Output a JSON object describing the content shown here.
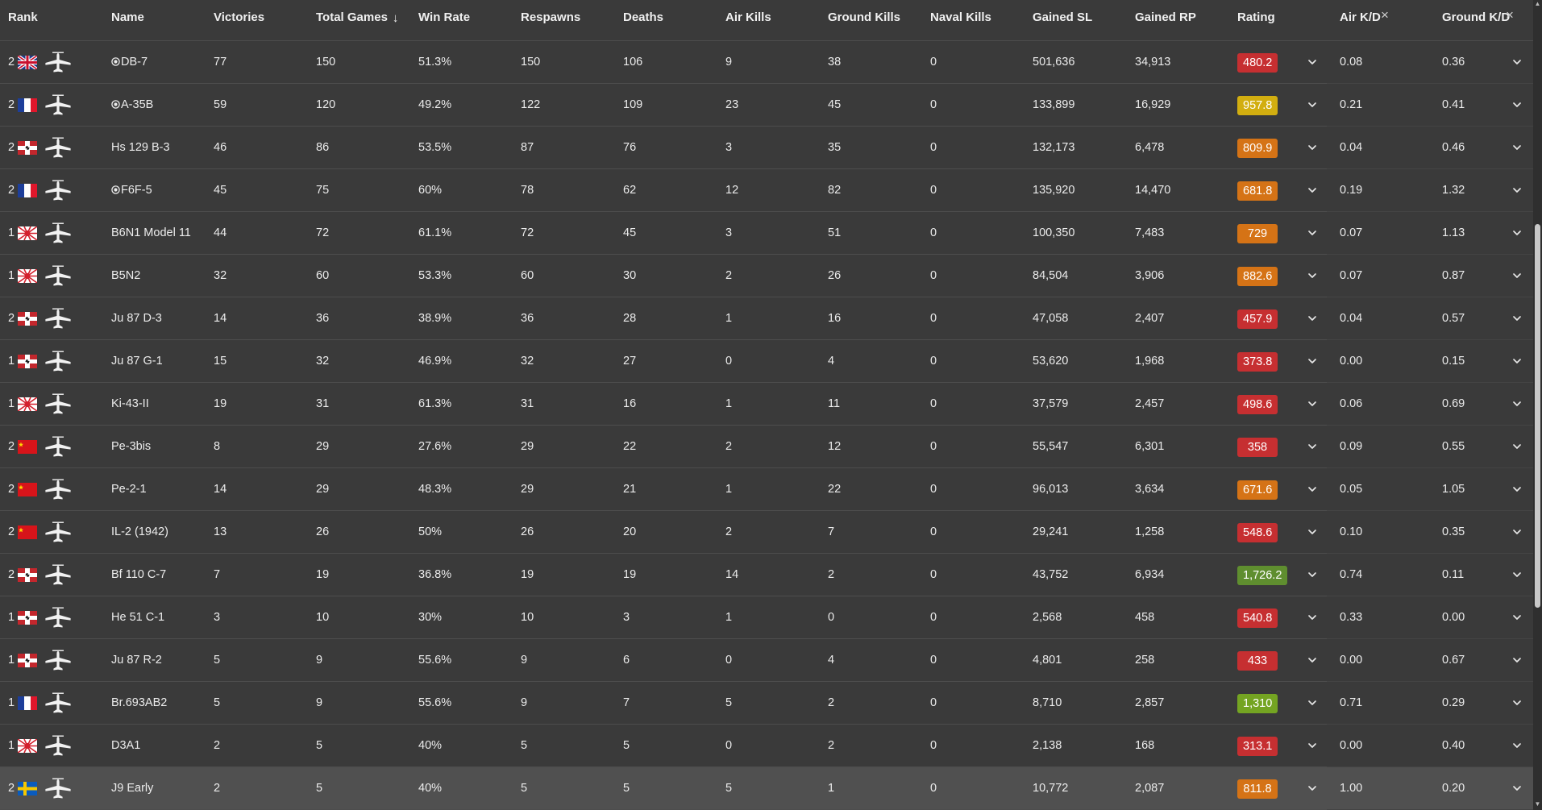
{
  "columns": {
    "rank": "Rank",
    "name": "Name",
    "victories": "Victories",
    "total_games": "Total Games",
    "win_rate": "Win Rate",
    "respawns": "Respawns",
    "deaths": "Deaths",
    "air_kills": "Air Kills",
    "ground_kills": "Ground Kills",
    "naval_kills": "Naval Kills",
    "gained_sl": "Gained SL",
    "gained_rp": "Gained RP",
    "rating": "Rating",
    "air_kd": "Air K/D",
    "ground_kd": "Ground K/D"
  },
  "icons": {
    "sort": "arrow-down-icon",
    "close": "close-icon",
    "expand": "chevron-down-icon",
    "vehicle": "plane-icon",
    "premium": "premium-target-icon"
  },
  "colors": {
    "rating_red": "#c62f31",
    "rating_orange": "#d57316",
    "rating_yellow": "#d2ae10",
    "rating_green": "#5f8e2f",
    "rating_lightgreen": "#74a422"
  },
  "rows": [
    {
      "rank": "2",
      "nation": "uk",
      "premium": true,
      "name": "DB-7",
      "victories": "77",
      "total": "150",
      "win_rate": "51.3%",
      "respawns": "150",
      "deaths": "106",
      "air_kills": "9",
      "ground_kills": "38",
      "naval_kills": "0",
      "sl": "501,636",
      "rp": "34,913",
      "rating": "480.2",
      "rating_color": "red",
      "air_kd": "0.08",
      "ground_kd": "0.36"
    },
    {
      "rank": "2",
      "nation": "france",
      "premium": true,
      "name": "A-35B",
      "victories": "59",
      "total": "120",
      "win_rate": "49.2%",
      "respawns": "122",
      "deaths": "109",
      "air_kills": "23",
      "ground_kills": "45",
      "naval_kills": "0",
      "sl": "133,899",
      "rp": "16,929",
      "rating": "957.8",
      "rating_color": "yellow",
      "air_kd": "0.21",
      "ground_kd": "0.41"
    },
    {
      "rank": "2",
      "nation": "germany",
      "premium": false,
      "name": "Hs 129 B-3",
      "victories": "46",
      "total": "86",
      "win_rate": "53.5%",
      "respawns": "87",
      "deaths": "76",
      "air_kills": "3",
      "ground_kills": "35",
      "naval_kills": "0",
      "sl": "132,173",
      "rp": "6,478",
      "rating": "809.9",
      "rating_color": "orange",
      "air_kd": "0.04",
      "ground_kd": "0.46"
    },
    {
      "rank": "2",
      "nation": "france",
      "premium": true,
      "name": "F6F-5",
      "victories": "45",
      "total": "75",
      "win_rate": "60%",
      "respawns": "78",
      "deaths": "62",
      "air_kills": "12",
      "ground_kills": "82",
      "naval_kills": "0",
      "sl": "135,920",
      "rp": "14,470",
      "rating": "681.8",
      "rating_color": "orange",
      "air_kd": "0.19",
      "ground_kd": "1.32"
    },
    {
      "rank": "1",
      "nation": "japan",
      "premium": false,
      "name": "B6N1 Model 11",
      "victories": "44",
      "total": "72",
      "win_rate": "61.1%",
      "respawns": "72",
      "deaths": "45",
      "air_kills": "3",
      "ground_kills": "51",
      "naval_kills": "0",
      "sl": "100,350",
      "rp": "7,483",
      "rating": "729",
      "rating_color": "orange",
      "air_kd": "0.07",
      "ground_kd": "1.13"
    },
    {
      "rank": "1",
      "nation": "japan",
      "premium": false,
      "name": "B5N2",
      "victories": "32",
      "total": "60",
      "win_rate": "53.3%",
      "respawns": "60",
      "deaths": "30",
      "air_kills": "2",
      "ground_kills": "26",
      "naval_kills": "0",
      "sl": "84,504",
      "rp": "3,906",
      "rating": "882.6",
      "rating_color": "orange",
      "air_kd": "0.07",
      "ground_kd": "0.87"
    },
    {
      "rank": "2",
      "nation": "germany",
      "premium": false,
      "name": "Ju 87 D-3",
      "victories": "14",
      "total": "36",
      "win_rate": "38.9%",
      "respawns": "36",
      "deaths": "28",
      "air_kills": "1",
      "ground_kills": "16",
      "naval_kills": "0",
      "sl": "47,058",
      "rp": "2,407",
      "rating": "457.9",
      "rating_color": "red",
      "air_kd": "0.04",
      "ground_kd": "0.57"
    },
    {
      "rank": "1",
      "nation": "germany",
      "premium": false,
      "name": "Ju 87 G-1",
      "victories": "15",
      "total": "32",
      "win_rate": "46.9%",
      "respawns": "32",
      "deaths": "27",
      "air_kills": "0",
      "ground_kills": "4",
      "naval_kills": "0",
      "sl": "53,620",
      "rp": "1,968",
      "rating": "373.8",
      "rating_color": "red",
      "air_kd": "0.00",
      "ground_kd": "0.15"
    },
    {
      "rank": "1",
      "nation": "japan",
      "premium": false,
      "name": "Ki-43-II",
      "victories": "19",
      "total": "31",
      "win_rate": "61.3%",
      "respawns": "31",
      "deaths": "16",
      "air_kills": "1",
      "ground_kills": "11",
      "naval_kills": "0",
      "sl": "37,579",
      "rp": "2,457",
      "rating": "498.6",
      "rating_color": "red",
      "air_kd": "0.06",
      "ground_kd": "0.69"
    },
    {
      "rank": "2",
      "nation": "ussr",
      "premium": false,
      "name": "Pe-3bis",
      "victories": "8",
      "total": "29",
      "win_rate": "27.6%",
      "respawns": "29",
      "deaths": "22",
      "air_kills": "2",
      "ground_kills": "12",
      "naval_kills": "0",
      "sl": "55,547",
      "rp": "6,301",
      "rating": "358",
      "rating_color": "red",
      "air_kd": "0.09",
      "ground_kd": "0.55"
    },
    {
      "rank": "2",
      "nation": "ussr",
      "premium": false,
      "name": "Pe-2-1",
      "victories": "14",
      "total": "29",
      "win_rate": "48.3%",
      "respawns": "29",
      "deaths": "21",
      "air_kills": "1",
      "ground_kills": "22",
      "naval_kills": "0",
      "sl": "96,013",
      "rp": "3,634",
      "rating": "671.6",
      "rating_color": "orange",
      "air_kd": "0.05",
      "ground_kd": "1.05"
    },
    {
      "rank": "2",
      "nation": "ussr",
      "premium": false,
      "name": "IL-2 (1942)",
      "victories": "13",
      "total": "26",
      "win_rate": "50%",
      "respawns": "26",
      "deaths": "20",
      "air_kills": "2",
      "ground_kills": "7",
      "naval_kills": "0",
      "sl": "29,241",
      "rp": "1,258",
      "rating": "548.6",
      "rating_color": "red",
      "air_kd": "0.10",
      "ground_kd": "0.35"
    },
    {
      "rank": "2",
      "nation": "germany",
      "premium": false,
      "name": "Bf 110 C-7",
      "victories": "7",
      "total": "19",
      "win_rate": "36.8%",
      "respawns": "19",
      "deaths": "19",
      "air_kills": "14",
      "ground_kills": "2",
      "naval_kills": "0",
      "sl": "43,752",
      "rp": "6,934",
      "rating": "1,726.2",
      "rating_color": "green",
      "air_kd": "0.74",
      "ground_kd": "0.11"
    },
    {
      "rank": "1",
      "nation": "germany",
      "premium": false,
      "name": "He 51 C-1",
      "victories": "3",
      "total": "10",
      "win_rate": "30%",
      "respawns": "10",
      "deaths": "3",
      "air_kills": "1",
      "ground_kills": "0",
      "naval_kills": "0",
      "sl": "2,568",
      "rp": "458",
      "rating": "540.8",
      "rating_color": "red",
      "air_kd": "0.33",
      "ground_kd": "0.00"
    },
    {
      "rank": "1",
      "nation": "germany",
      "premium": false,
      "name": "Ju 87 R-2",
      "victories": "5",
      "total": "9",
      "win_rate": "55.6%",
      "respawns": "9",
      "deaths": "6",
      "air_kills": "0",
      "ground_kills": "4",
      "naval_kills": "0",
      "sl": "4,801",
      "rp": "258",
      "rating": "433",
      "rating_color": "red",
      "air_kd": "0.00",
      "ground_kd": "0.67"
    },
    {
      "rank": "1",
      "nation": "france",
      "premium": false,
      "name": "Br.693AB2",
      "victories": "5",
      "total": "9",
      "win_rate": "55.6%",
      "respawns": "9",
      "deaths": "7",
      "air_kills": "5",
      "ground_kills": "2",
      "naval_kills": "0",
      "sl": "8,710",
      "rp": "2,857",
      "rating": "1,310",
      "rating_color": "lightgreen",
      "air_kd": "0.71",
      "ground_kd": "0.29"
    },
    {
      "rank": "1",
      "nation": "japan",
      "premium": false,
      "name": "D3A1",
      "victories": "2",
      "total": "5",
      "win_rate": "40%",
      "respawns": "5",
      "deaths": "5",
      "air_kills": "0",
      "ground_kills": "2",
      "naval_kills": "0",
      "sl": "2,138",
      "rp": "168",
      "rating": "313.1",
      "rating_color": "red",
      "air_kd": "0.00",
      "ground_kd": "0.40"
    },
    {
      "rank": "2",
      "nation": "sweden",
      "premium": false,
      "name": "J9 Early",
      "victories": "2",
      "total": "5",
      "win_rate": "40%",
      "respawns": "5",
      "deaths": "5",
      "air_kills": "5",
      "ground_kills": "1",
      "naval_kills": "0",
      "sl": "10,772",
      "rp": "2,087",
      "rating": "811.8",
      "rating_color": "orange",
      "air_kd": "1.00",
      "ground_kd": "0.20",
      "highlighted": true
    }
  ]
}
